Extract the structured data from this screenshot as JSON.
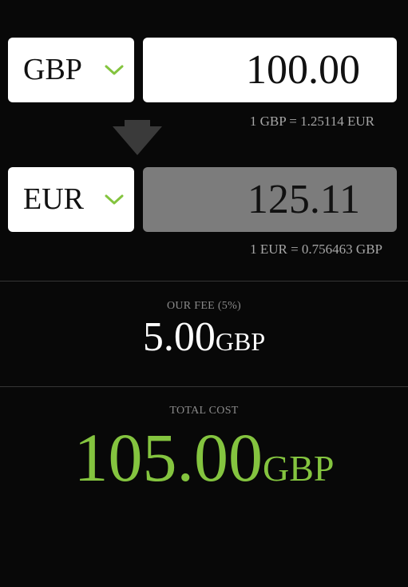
{
  "converter": {
    "from": {
      "currency": "GBP",
      "amount": "100.00",
      "rate_text": "1 GBP = 1.25114 EUR"
    },
    "to": {
      "currency": "EUR",
      "amount": "125.11",
      "rate_text": "1 EUR = 0.756463 GBP"
    }
  },
  "fee": {
    "label": "OUR FEE (5%)",
    "value": "5.00",
    "currency": "GBP"
  },
  "total": {
    "label": "TOTAL COST",
    "value": "105.00",
    "currency": "GBP"
  },
  "icons": {
    "dropdown": "chevron-down-icon",
    "swap": "arrow-down-icon"
  },
  "colors": {
    "background": "#080808",
    "accent_green": "#84c43f",
    "field_white": "#ffffff",
    "field_readonly": "#7c7c7c",
    "muted_text": "#a6a6a6",
    "arrow": "#3a3a3a"
  }
}
